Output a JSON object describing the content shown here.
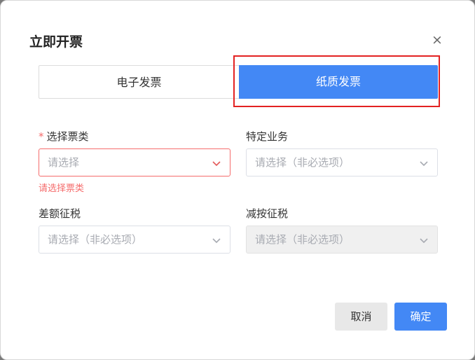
{
  "dialog": {
    "title": "立即开票",
    "close_icon": "×"
  },
  "invoice_types": {
    "electronic": "电子发票",
    "paper": "纸质发票",
    "selected": "paper"
  },
  "fields": {
    "ticket_type": {
      "required_mark": "*",
      "label": "选择票类",
      "placeholder": "请选择",
      "error": "请选择票类"
    },
    "special_business": {
      "label": "特定业务",
      "placeholder": "请选择（非必选项）"
    },
    "differential_tax": {
      "label": "差额征税",
      "placeholder": "请选择（非必选项）"
    },
    "reduced_tax": {
      "label": "减按征税",
      "placeholder": "请选择（非必选项）",
      "disabled": true
    }
  },
  "footer": {
    "cancel_label": "取消",
    "confirm_label": "确定"
  },
  "colors": {
    "accent": "#4388f5",
    "error": "#f56c6c",
    "highlight": "#e32222"
  }
}
